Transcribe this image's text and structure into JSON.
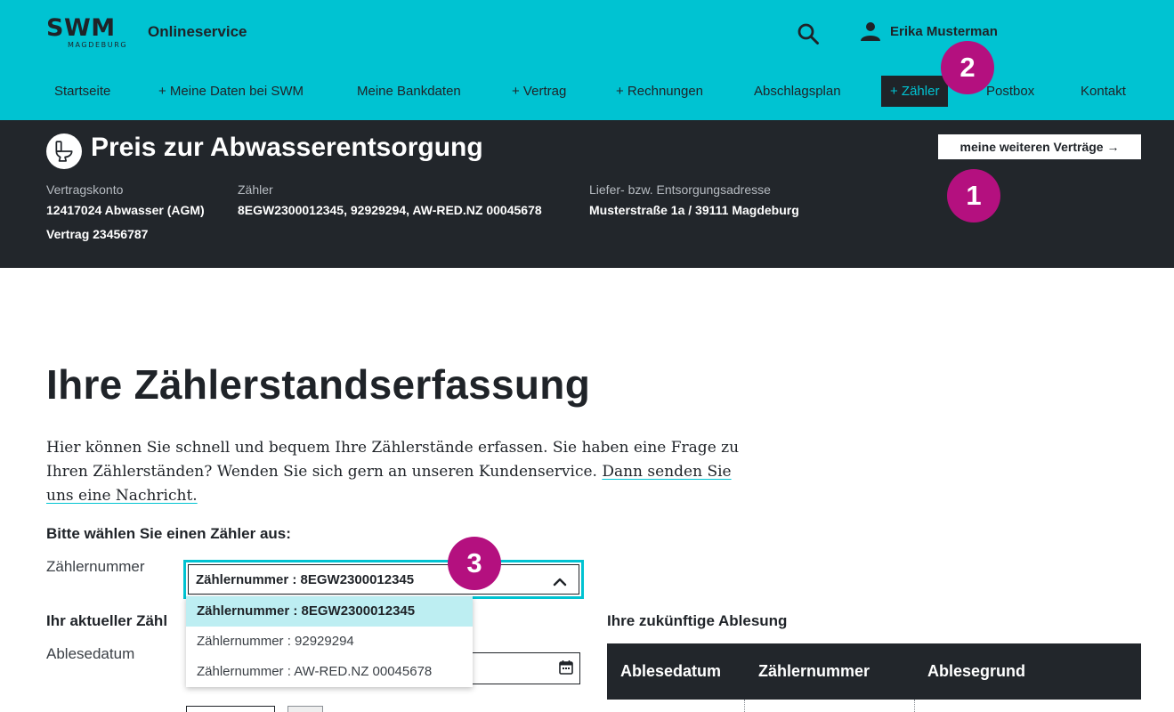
{
  "header": {
    "logo_main": "SWM",
    "logo_sub": "MAGDEBURG",
    "app_name": "Onlineservice",
    "user_name": "Erika Musterman",
    "icons": {
      "search": "search-icon",
      "user": "user-icon"
    },
    "colors": {
      "accent": "#00c3d2",
      "dark": "#22262b",
      "badge": "#b4107f"
    }
  },
  "nav": {
    "items": [
      {
        "label": "Startseite"
      },
      {
        "label": "+ Meine Daten bei SWM"
      },
      {
        "label": "Meine Bankdaten"
      },
      {
        "label": "+ Vertrag"
      },
      {
        "label": "+ Rechnungen"
      },
      {
        "label": "Abschlagsplan"
      },
      {
        "label": "+ Zähler",
        "active": true
      },
      {
        "label": "Postbox"
      },
      {
        "label": "Kontakt"
      }
    ]
  },
  "contract": {
    "title": "Preis zur Abwasserentsorgung",
    "more_button": "meine weiteren Verträge →",
    "account_label": "Vertragskonto",
    "account_value": "12417024 Abwasser (AGM)",
    "contract_value": "Vertrag 23456787",
    "meter_label": "Zähler",
    "meter_value": "8EGW2300012345, 92929294, AW-RED.NZ 00045678",
    "address_label": "Liefer- bzw. Entsorgungsadresse",
    "address_value": "Musterstraße 1a / 39111 Magdeburg"
  },
  "badges": [
    "1",
    "2",
    "3"
  ],
  "main": {
    "title": "Ihre Zählerstandserfassung",
    "intro_text": "Hier können Sie schnell und bequem Ihre Zählerstände erfassen. Sie haben eine Frage zu Ihren Zählerständen? Wenden Sie sich gern an unseren Kundenservice. ",
    "intro_link": "Dann senden Sie uns eine Nachricht.",
    "select_prompt": "Bitte wählen Sie einen Zähler aus:",
    "meter_label": "Zählernummer",
    "meter_selected": "Zählernummer : 8EGW2300012345",
    "meter_options": [
      "Zählernummer : 8EGW2300012345",
      "Zählernummer : 92929294",
      "Zählernummer : AW-RED.NZ 00045678"
    ],
    "current_reading_head": "Ihr aktueller Zähl",
    "reading_date_label": "Ablesedatum",
    "future_reading_head": "Ihre zukünftige Ablesung",
    "future_table_headers": [
      "Ablesedatum",
      "Zählernummer",
      "Ablesegrund"
    ]
  }
}
